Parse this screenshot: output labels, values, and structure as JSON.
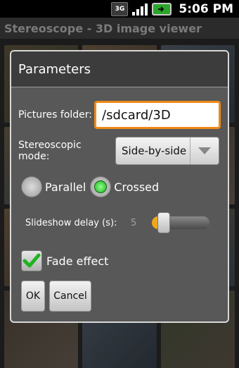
{
  "status_bar": {
    "network_label": "3G",
    "battery_icon": "battery-icon",
    "time": "5:06 PM"
  },
  "app": {
    "title": "Stereoscope - 3D image viewer"
  },
  "dialog": {
    "title": "Parameters",
    "pictures_folder": {
      "label": "Pictures folder:",
      "value": "/sdcard/3D"
    },
    "stereoscopic_mode": {
      "label": "Stereoscopic mode:",
      "selected": "Side-by-side"
    },
    "view_mode": {
      "options": [
        {
          "label": "Parallel",
          "checked": false
        },
        {
          "label": "Crossed",
          "checked": true
        }
      ]
    },
    "slideshow_delay": {
      "label": "Slideshow delay (s):",
      "value": "5",
      "fill_fraction": 0.12
    },
    "fade_effect": {
      "label": "Fade effect",
      "checked": true
    },
    "buttons": {
      "ok": "OK",
      "cancel": "Cancel"
    }
  },
  "colors": {
    "accent_orange": "#f08a18",
    "radio_green": "#1fb31f",
    "dialog_bg": "#585858",
    "header_bg": "#3c3c3c"
  }
}
